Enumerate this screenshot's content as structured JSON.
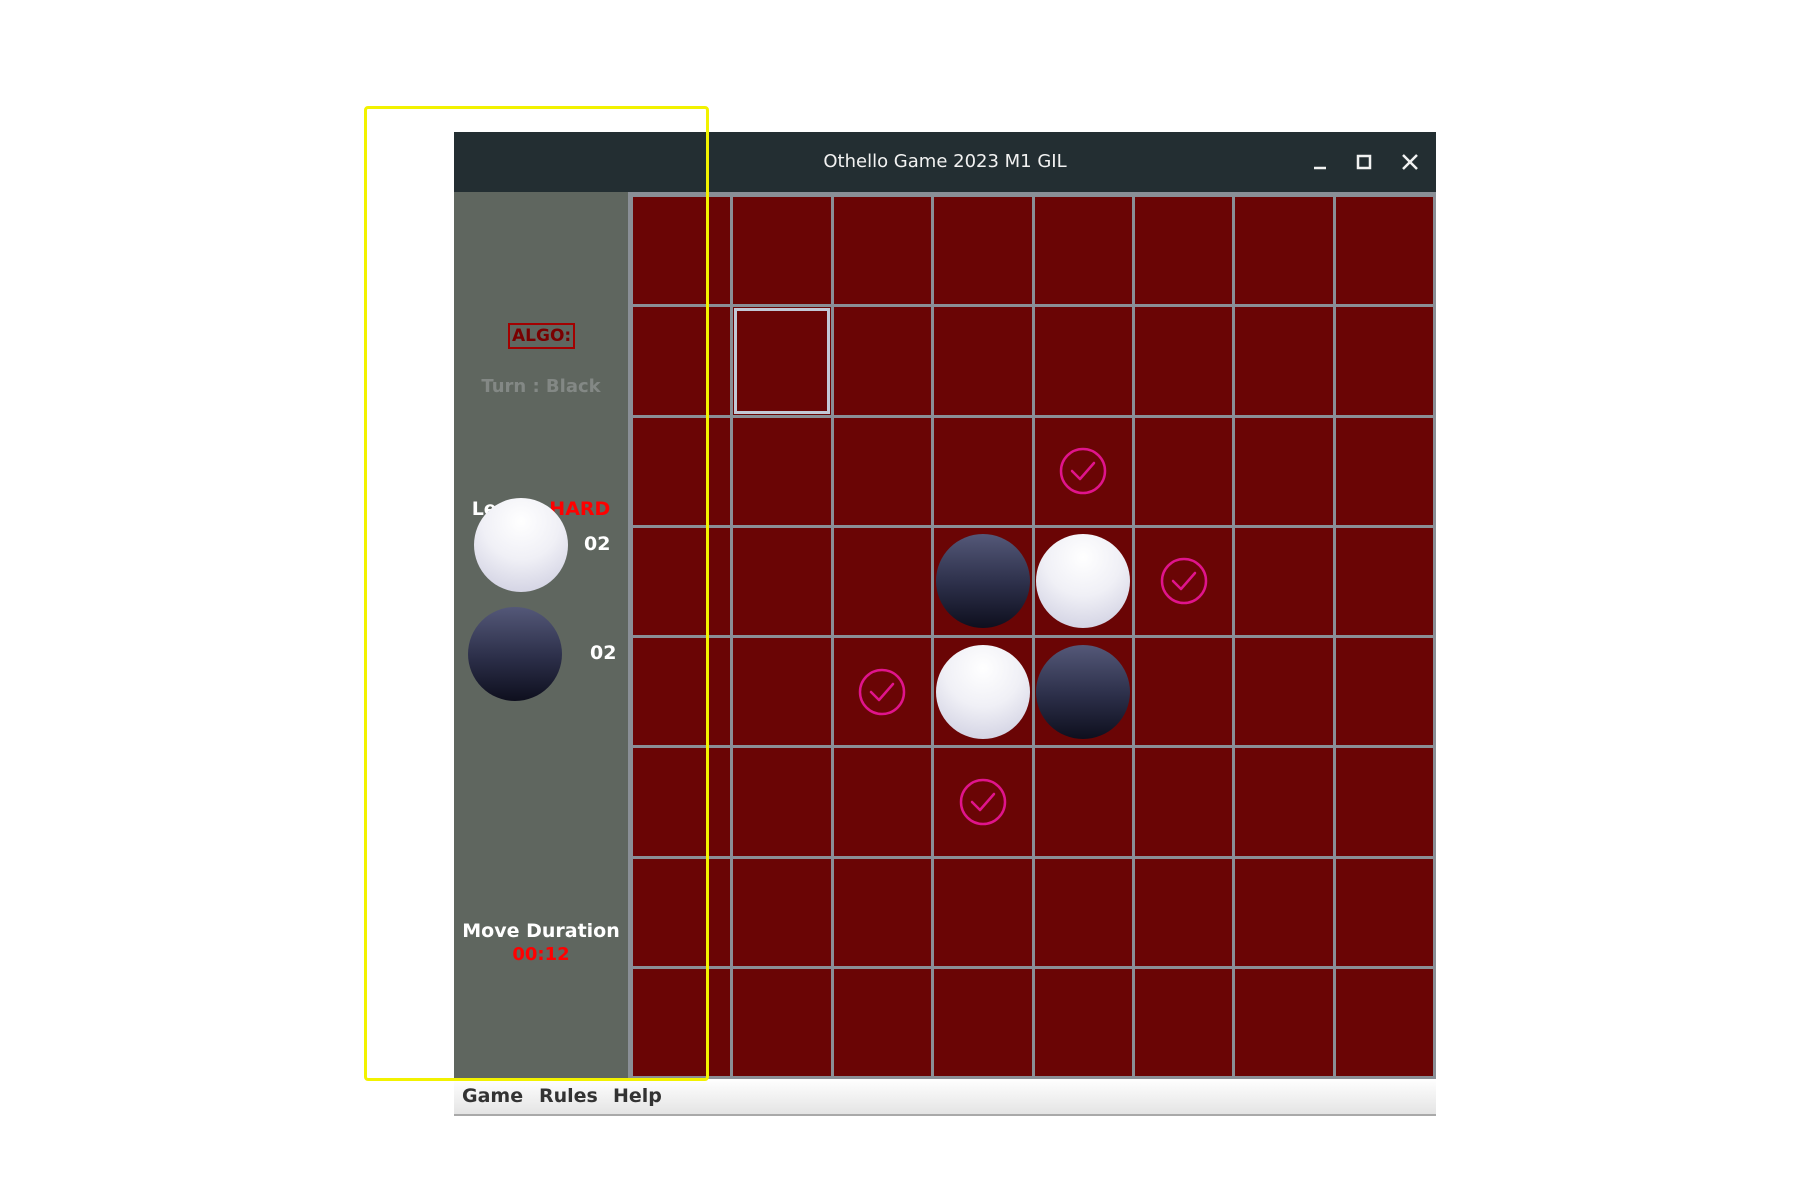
{
  "window": {
    "title": "Othello Game 2023 M1 GIL",
    "controls": [
      "minimize-icon",
      "maximize-icon",
      "close-icon"
    ]
  },
  "sidebar": {
    "algo_label": "ALGO:",
    "turn_text": "Turn : Black",
    "level_label": "Level : ",
    "level_value": "HARD",
    "white_score": "02",
    "black_score": "02",
    "move_duration_label": "Move Duration",
    "move_duration_value": "00:12"
  },
  "board": {
    "size": 8,
    "focused_cell": [
      1,
      1
    ],
    "discs": [
      {
        "row": 3,
        "col": 3,
        "color": "black"
      },
      {
        "row": 3,
        "col": 4,
        "color": "white"
      },
      {
        "row": 4,
        "col": 3,
        "color": "white"
      },
      {
        "row": 4,
        "col": 4,
        "color": "black"
      }
    ],
    "legal_move_hints": [
      {
        "row": 2,
        "col": 4
      },
      {
        "row": 3,
        "col": 5
      },
      {
        "row": 4,
        "col": 2
      },
      {
        "row": 5,
        "col": 3
      }
    ]
  },
  "menu": {
    "items": [
      "Game",
      "Rules",
      "Help"
    ]
  },
  "colors": {
    "board_cell": "#6a0505",
    "grid_line": "#8a8f96",
    "sidebar": "#5f665f",
    "titlebar": "#232e32",
    "hint": "#e0148c",
    "level_value": "#ff0000",
    "highlight": "#f2f200"
  }
}
